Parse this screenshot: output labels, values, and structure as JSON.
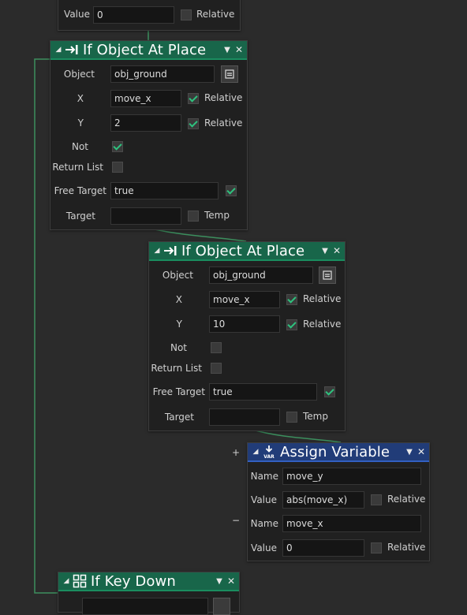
{
  "top_fragment": {
    "value_label": "Value",
    "value": "0",
    "relative_label": "Relative",
    "relative_checked": false
  },
  "block1": {
    "title": "If Object At Place",
    "object_label": "Object",
    "object": "obj_ground",
    "x_label": "X",
    "x": "move_x",
    "x_relative_label": "Relative",
    "x_relative": true,
    "y_label": "Y",
    "y": "2",
    "y_relative_label": "Relative",
    "y_relative": true,
    "not_label": "Not",
    "not": true,
    "return_list_label": "Return List",
    "return_list": false,
    "free_target_label": "Free Target",
    "free_target": "true",
    "free_target_checked": true,
    "target_label": "Target",
    "target": "",
    "temp_label": "Temp",
    "temp": false
  },
  "block2": {
    "title": "If Object At Place",
    "object_label": "Object",
    "object": "obj_ground",
    "x_label": "X",
    "x": "move_x",
    "x_relative_label": "Relative",
    "x_relative": true,
    "y_label": "Y",
    "y": "10",
    "y_relative_label": "Relative",
    "y_relative": true,
    "not_label": "Not",
    "not": false,
    "return_list_label": "Return List",
    "return_list": false,
    "free_target_label": "Free Target",
    "free_target": "true",
    "free_target_checked": true,
    "target_label": "Target",
    "target": "",
    "temp_label": "Temp",
    "temp": false
  },
  "assign": {
    "title": "Assign Variable",
    "add": "+",
    "remove": "−",
    "rows": [
      {
        "name_label": "Name",
        "name": "move_y",
        "value_label": "Value",
        "value": "abs(move_x)",
        "relative_label": "Relative",
        "relative": false
      },
      {
        "name_label": "Name",
        "name": "move_x",
        "value_label": "Value",
        "value": "0",
        "relative_label": "Relative",
        "relative": false
      }
    ]
  },
  "keydown": {
    "title": "If Key Down"
  },
  "colors": {
    "canvas": "#2b2b2b",
    "block_body": "#202020",
    "green_header": "#18664a",
    "blue_header": "#213c78",
    "wire": "#3c8f5e",
    "check": "#2ec27e"
  },
  "icons": {
    "collapse": "triangle-collapse-icon",
    "goto": "arrow-to-bar-icon",
    "var": "var-download-icon",
    "keydown": "key-grid-icon",
    "menu": "chevron-down-icon",
    "close": "close-icon",
    "object_picker": "object-picker-icon"
  }
}
